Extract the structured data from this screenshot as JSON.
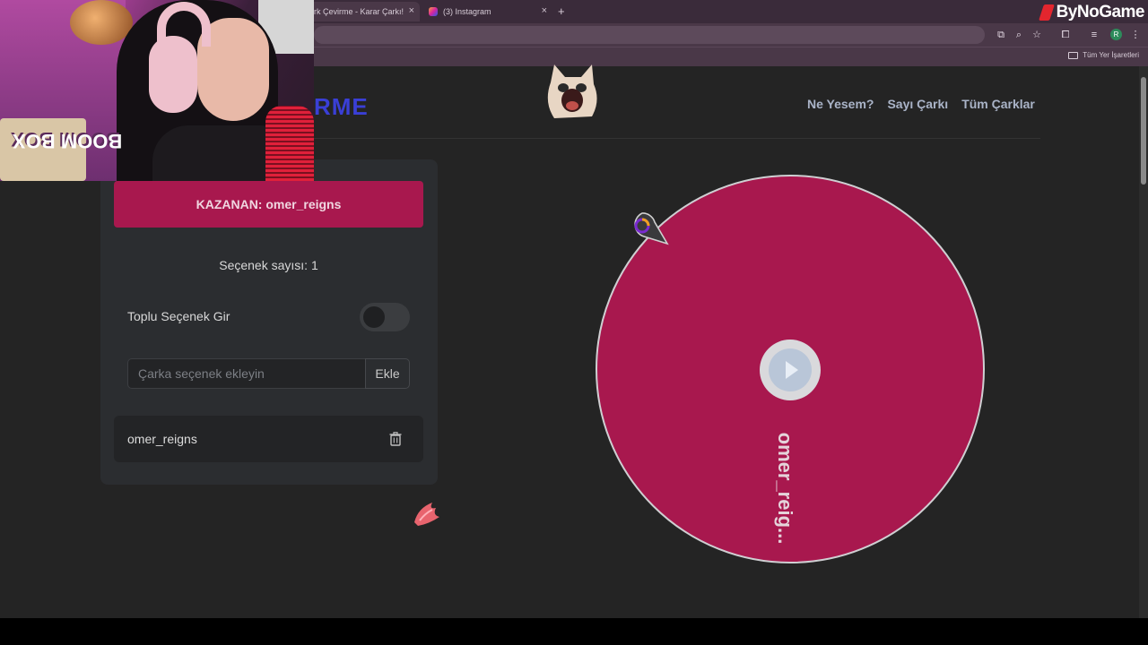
{
  "browser": {
    "tabs": [
      {
        "label": "rk Çevirme - Karar Çarkı!"
      },
      {
        "label": "(3) Instagram"
      }
    ],
    "new_tab": "+",
    "close_glyph": "×",
    "brand": "ByNoGame",
    "bookmarks_label": "Tüm Yer İşaretleri",
    "profile_initial": "R"
  },
  "site": {
    "logo_partial": "RME",
    "nav": [
      "Ne Yesem?",
      "Sayı Çarkı",
      "Tüm Çarklar"
    ]
  },
  "panel": {
    "winner": "KAZANAN: omer_reigns",
    "option_count": "Seçenek sayısı: 1",
    "bulk_toggle_label": "Toplu Seçenek Gir",
    "bulk_toggle_on": false,
    "add_placeholder": "Çarka seçenek ekleyin",
    "add_button": "Ekle",
    "items": [
      {
        "label": "omer_reigns"
      }
    ]
  },
  "wheel": {
    "segments": [
      {
        "label": "omer_reig...",
        "color": "#a8184e"
      }
    ],
    "spin_icon": "play-icon"
  },
  "webcam": {
    "box_text": "BOOM BOX"
  },
  "colors": {
    "accent": "#a8184e",
    "page_bg": "#242424",
    "panel_bg": "#2b2d30",
    "logo": "#3a3fd6"
  }
}
